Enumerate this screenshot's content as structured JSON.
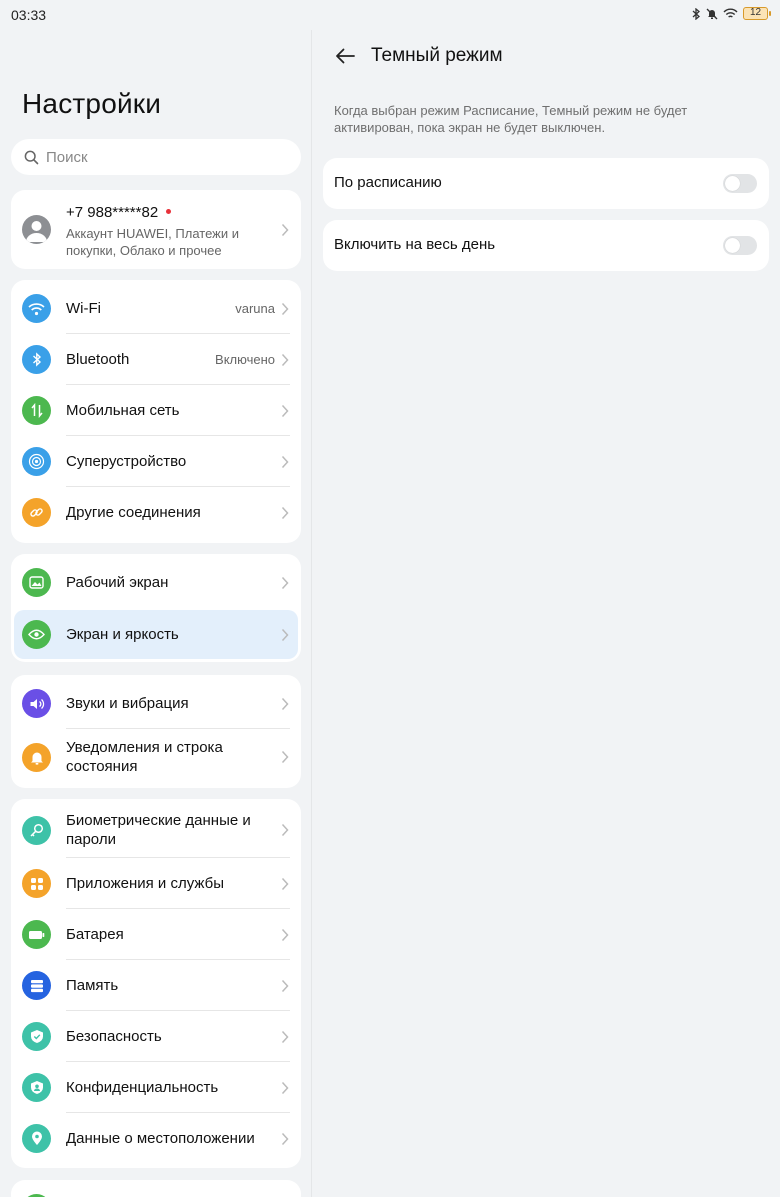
{
  "status": {
    "time": "03:33",
    "battery": "12"
  },
  "left": {
    "title": "Настройки",
    "search_placeholder": "Поиск",
    "account": {
      "phone": "+7 988*****82",
      "subtitle": "Аккаунт HUAWEI, Платежи и покупки, Облако и прочее"
    },
    "group1": [
      {
        "label": "Wi-Fi",
        "value": "varuna",
        "icon": "wifi-icon",
        "color": "#3aa0e8"
      },
      {
        "label": "Bluetooth",
        "value": "Включено",
        "icon": "bluetooth-icon",
        "color": "#3aa0e8"
      },
      {
        "label": "Мобильная сеть",
        "value": "",
        "icon": "mobile-network-icon",
        "color": "#4cb84f"
      },
      {
        "label": "Суперустройство",
        "value": "",
        "icon": "superdevice-icon",
        "color": "#3aa0e8"
      },
      {
        "label": "Другие соединения",
        "value": "",
        "icon": "link-icon",
        "color": "#f4a32a"
      }
    ],
    "group2": [
      {
        "label": "Рабочий экран",
        "icon": "home-screen-icon",
        "color": "#4cb84f"
      },
      {
        "label": "Экран и яркость",
        "icon": "eye-icon",
        "color": "#4cb84f"
      }
    ],
    "group3": [
      {
        "label": "Звуки и вибрация",
        "icon": "sound-icon",
        "color": "#6a4fe6"
      },
      {
        "label": "Уведомления и строка состояния",
        "icon": "bell-icon",
        "color": "#f4a32a"
      }
    ],
    "group4": [
      {
        "label": "Биометрические данные и пароли",
        "icon": "key-icon",
        "color": "#3ec2a8"
      },
      {
        "label": "Приложения и службы",
        "icon": "apps-icon",
        "color": "#f4a32a"
      },
      {
        "label": "Батарея",
        "icon": "battery-icon",
        "color": "#4cb84f"
      },
      {
        "label": "Память",
        "icon": "storage-icon",
        "color": "#2563e0"
      },
      {
        "label": "Безопасность",
        "icon": "shield-icon",
        "color": "#3ec2a8"
      },
      {
        "label": "Конфиденциальность",
        "icon": "privacy-icon",
        "color": "#3ec2a8"
      },
      {
        "label": "Данные о местоположении",
        "icon": "location-icon",
        "color": "#3ec2a8"
      }
    ]
  },
  "right": {
    "title": "Темный режим",
    "hint": "Когда выбран режим Расписание, Темный режим не будет активирован, пока экран не будет выключен.",
    "options": [
      {
        "label": "По расписанию",
        "enabled": false
      },
      {
        "label": "Включить на весь день",
        "enabled": false
      }
    ]
  }
}
